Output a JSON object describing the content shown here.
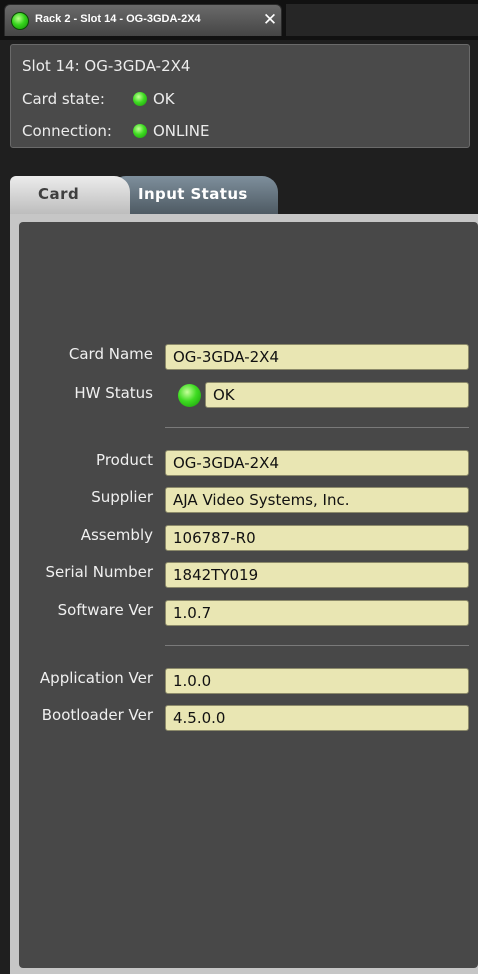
{
  "window_tab": {
    "title": "Rack 2 - Slot 14 - OG-3GDA-2X4",
    "close_glyph": "✕",
    "status_color": "#35d41c"
  },
  "info": {
    "slot": "Slot 14: OG-3GDA-2X4",
    "card_state_label": "Card state:",
    "card_state_value": "OK",
    "connection_label": "Connection:",
    "connection_value": "ONLINE"
  },
  "tabs": [
    {
      "label": "Card",
      "active": true
    },
    {
      "label": "Input Status",
      "active": false
    }
  ],
  "card": {
    "card_name": {
      "label": "Card Name",
      "value": "OG-3GDA-2X4"
    },
    "hw_status": {
      "label": "HW Status",
      "value": "OK"
    },
    "product": {
      "label": "Product",
      "value": "OG-3GDA-2X4"
    },
    "supplier": {
      "label": "Supplier",
      "value": "AJA Video Systems, Inc."
    },
    "assembly": {
      "label": "Assembly",
      "value": "106787-R0"
    },
    "serial_number": {
      "label": "Serial Number",
      "value": "1842TY019"
    },
    "software_ver": {
      "label": "Software Ver",
      "value": "1.0.7"
    },
    "application_ver": {
      "label": "Application Ver",
      "value": "1.0.0"
    },
    "bootloader_ver": {
      "label": "Bootloader Ver",
      "value": "4.5.0.0"
    }
  },
  "colors": {
    "led_green": "#3fdc22",
    "field_bg": "#e9e6b3",
    "panel_bg": "#484848"
  }
}
